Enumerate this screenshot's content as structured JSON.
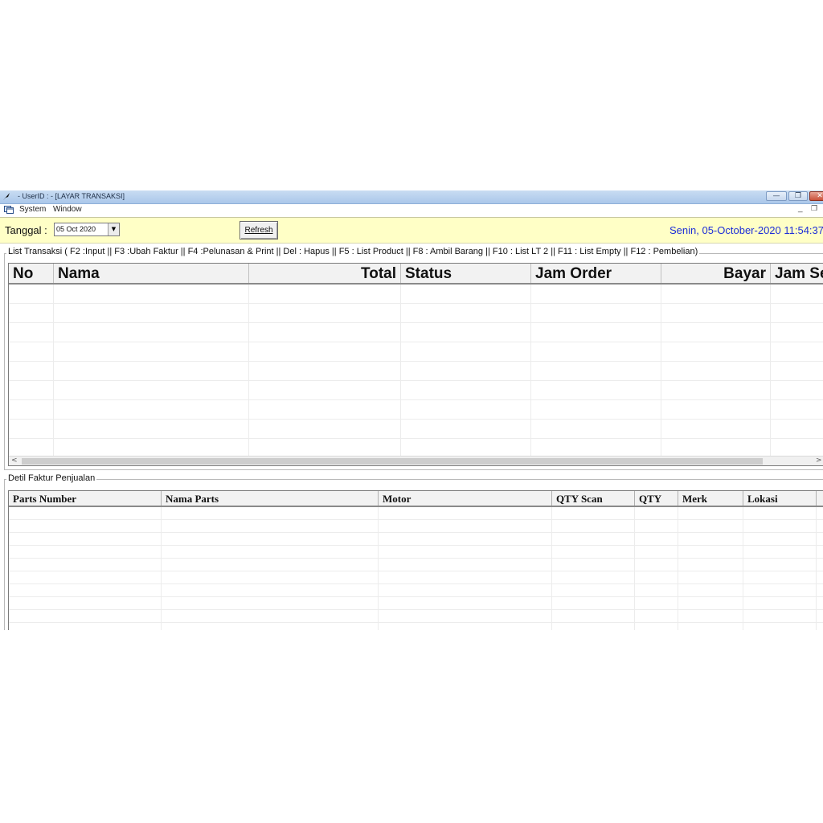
{
  "window": {
    "title": "- UserID :  - [LAYAR TRANSAKSI]",
    "min_glyph": "—",
    "max_glyph": "❐",
    "close_glyph": "✕"
  },
  "menu": {
    "items": [
      {
        "label": "System"
      },
      {
        "label": "Window"
      }
    ],
    "mdi_min": "_",
    "mdi_restore": "❐"
  },
  "toolbar": {
    "date_label": "Tanggal :",
    "date_value": "05 Oct 2020",
    "date_drop_glyph": "▼",
    "refresh_label": "Refresh",
    "datetime": "Senin, 05-October-2020 11:54:37"
  },
  "transaksi": {
    "legend": "List Transaksi ( F2 :Input || F3 :Ubah Faktur || F4 :Pelunasan & Print || Del : Hapus || F5 : List Product || F8 : Ambil Barang || F10 : List LT 2 || F11 : List Empty || F12 : Pembelian)",
    "columns": [
      "No",
      "Nama",
      "Total",
      "Status",
      "Jam Order",
      "Bayar",
      "Jam Selesai"
    ],
    "scroll_left": "<",
    "scroll_right": ">"
  },
  "detail": {
    "legend": "Detil Faktur Penjualan",
    "columns": [
      "Parts Number",
      "Nama Parts",
      "Motor",
      "QTY Scan",
      "QTY",
      "Merk",
      "Lokasi"
    ]
  }
}
